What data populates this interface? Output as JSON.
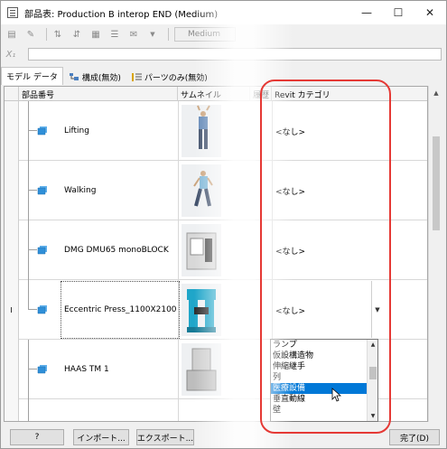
{
  "window": {
    "title": "部品表: Production B interop END (Medium)",
    "minimize_label": "—",
    "maximize_label": "☐",
    "close_label": "✕"
  },
  "toolbar": {
    "level_combo": "Medium"
  },
  "formula": {
    "fx_label": "X₁",
    "value": ""
  },
  "tabs": [
    {
      "label": "モデル データ"
    },
    {
      "label": "構成(無効)"
    },
    {
      "label": "パーツのみ(無効)"
    }
  ],
  "grid": {
    "columns": {
      "part_number": "部品番号",
      "thumbnail": "サムネイル",
      "history": "履歴",
      "revit_category": "Revit カテゴリ"
    },
    "rows": [
      {
        "name": "Lifting",
        "category": "<なし>"
      },
      {
        "name": "Walking",
        "category": "<なし>"
      },
      {
        "name": "DMG DMU65 monoBLOCK",
        "category": "<なし>"
      },
      {
        "name": "Eccentric Press_1100X2100···",
        "category": "<なし>",
        "row_marker": "I"
      },
      {
        "name": "HAAS TM 1",
        "category": ""
      },
      {
        "name": "",
        "category": ""
      }
    ]
  },
  "dropdown": {
    "items": [
      "ランプ",
      "仮設構造物",
      "伸縮継手",
      "列",
      "医療設備",
      "垂直動線",
      "壁"
    ],
    "selected": "医療設備"
  },
  "buttons": {
    "help": "?",
    "import": "インポート...",
    "export": "エクスポート...",
    "done": "完了(D)"
  },
  "colors": {
    "annotation": "#e53935",
    "selection": "#0078d7",
    "part_icon": "#2f8fd8",
    "press_machine": "#1fa6c9"
  }
}
